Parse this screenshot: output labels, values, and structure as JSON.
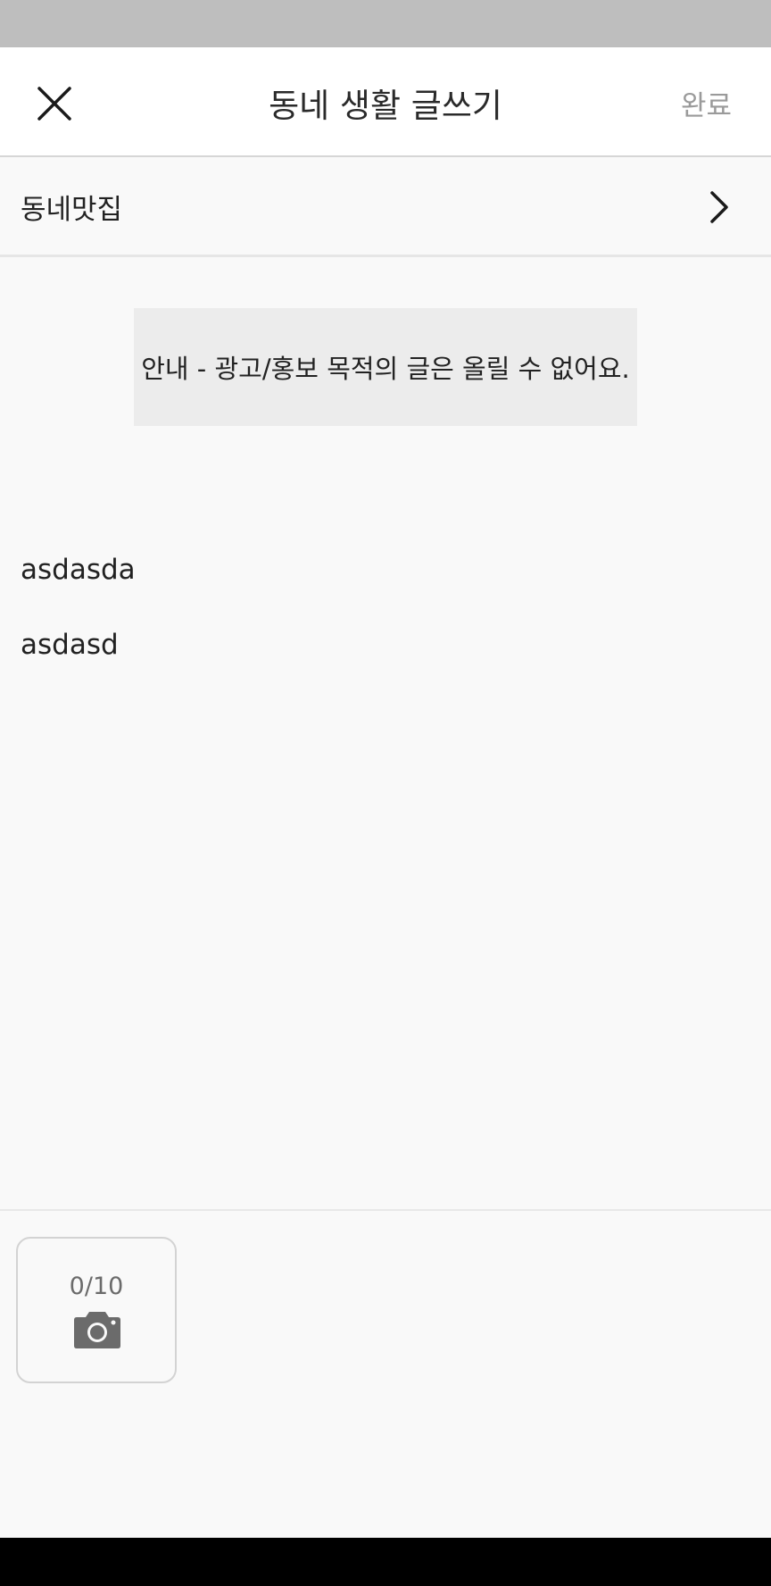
{
  "header": {
    "title": "동네 생활 글쓰기",
    "done_label": "완료"
  },
  "category": {
    "label": "동네맛집"
  },
  "notice": {
    "text": "안내 - 광고/홍보 목적의 글은 올릴 수 없어요."
  },
  "body": {
    "lines": [
      "asdasda",
      "asdasd"
    ]
  },
  "photos": {
    "count_text": "0/10"
  },
  "icons": {
    "close": "close-icon",
    "chevron": "chevron-right-icon",
    "camera": "camera-icon"
  },
  "colors": {
    "status_bar": "#bebebe",
    "background": "#f9f9f9",
    "notice_bg": "#ececec",
    "done_text": "#9a9a9a",
    "nav_bar": "#000000"
  }
}
